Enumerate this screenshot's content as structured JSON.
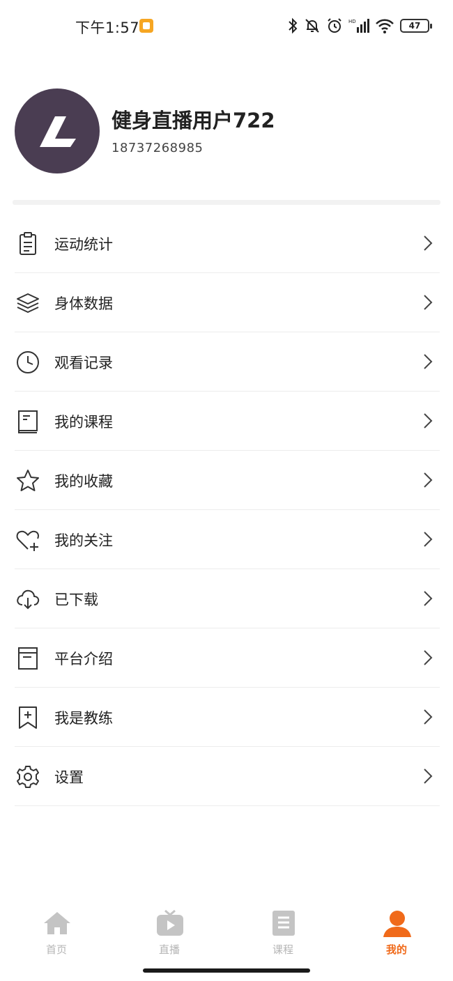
{
  "status": {
    "time": "下午1:57",
    "battery": "47"
  },
  "profile": {
    "name": "健身直播用户722",
    "phone": "18737268985"
  },
  "menu": [
    {
      "label": "运动统计",
      "icon": "clipboard-icon"
    },
    {
      "label": "身体数据",
      "icon": "layers-icon"
    },
    {
      "label": "观看记录",
      "icon": "clock-icon"
    },
    {
      "label": "我的课程",
      "icon": "book-icon"
    },
    {
      "label": "我的收藏",
      "icon": "star-icon"
    },
    {
      "label": "我的关注",
      "icon": "heart-plus-icon"
    },
    {
      "label": "已下载",
      "icon": "cloud-download-icon"
    },
    {
      "label": "平台介绍",
      "icon": "document-icon"
    },
    {
      "label": "我是教练",
      "icon": "bookmark-plus-icon"
    },
    {
      "label": "设置",
      "icon": "gear-icon"
    }
  ],
  "tabs": [
    {
      "label": "首页",
      "icon": "home-icon",
      "active": false
    },
    {
      "label": "直播",
      "icon": "tv-play-icon",
      "active": false
    },
    {
      "label": "课程",
      "icon": "course-book-icon",
      "active": false
    },
    {
      "label": "我的",
      "icon": "person-icon",
      "active": true
    }
  ],
  "colors": {
    "accent": "#f06a1a",
    "avatar_bg": "#4a3d52",
    "tab_inactive": "#b5b5b5"
  }
}
